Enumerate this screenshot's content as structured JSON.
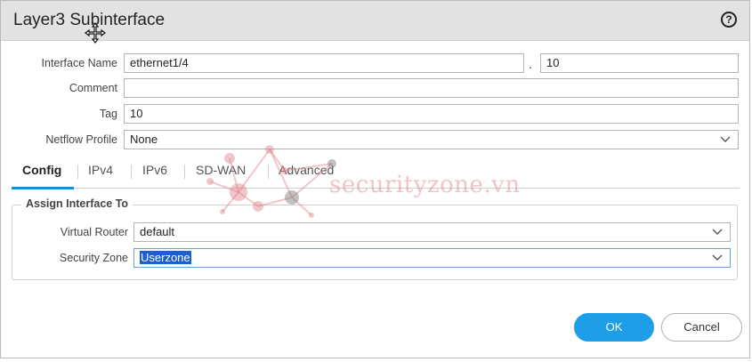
{
  "dialog": {
    "title": "Layer3 Subinterface",
    "help_icon": "question-circle-icon"
  },
  "form": {
    "interface_name_label": "Interface Name",
    "interface_name_value": "ethernet1/4",
    "separator": ".",
    "subinterface_number": "10",
    "comment_label": "Comment",
    "comment_value": "",
    "tag_label": "Tag",
    "tag_value": "10",
    "netflow_label": "Netflow Profile",
    "netflow_value": "None"
  },
  "tabs": [
    {
      "label": "Config",
      "active": true
    },
    {
      "label": "IPv4",
      "active": false
    },
    {
      "label": "IPv6",
      "active": false
    },
    {
      "label": "SD-WAN",
      "active": false
    },
    {
      "label": "Advanced",
      "active": false
    }
  ],
  "assign": {
    "legend": "Assign Interface To",
    "virtual_router_label": "Virtual Router",
    "virtual_router_value": "default",
    "security_zone_label": "Security Zone",
    "security_zone_value": "Userzone"
  },
  "buttons": {
    "ok": "OK",
    "cancel": "Cancel"
  },
  "watermark": "securityzone.vn",
  "colors": {
    "accent": "#1e9ee6",
    "titlebar": "#e2e2e2",
    "selection": "#1d5fd1"
  }
}
